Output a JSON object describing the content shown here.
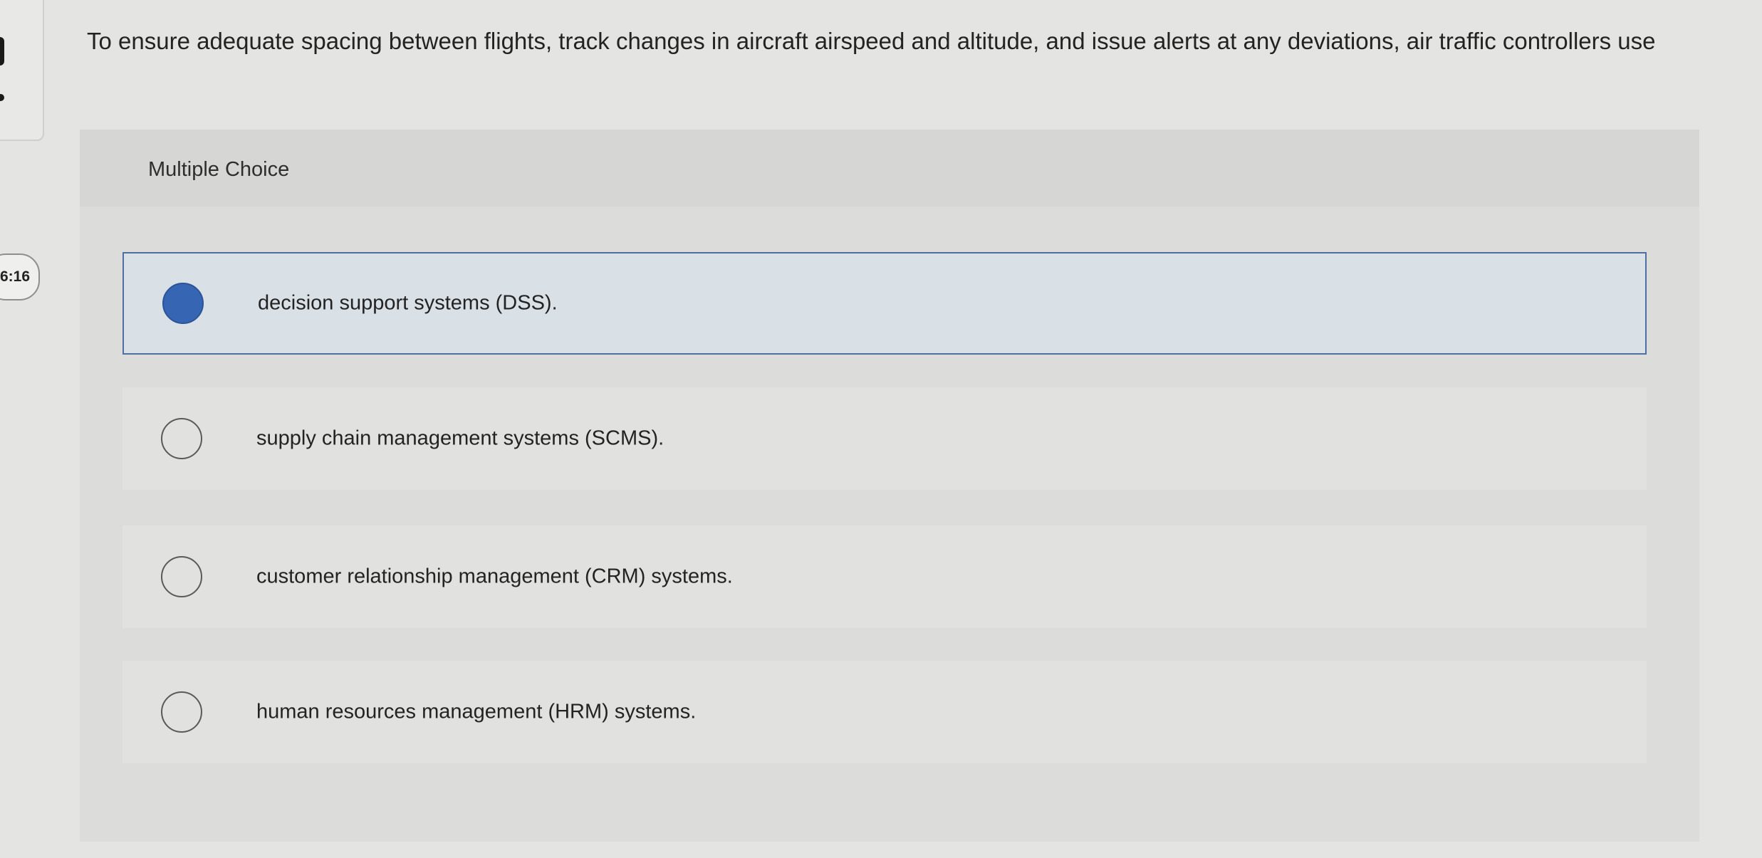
{
  "timer": "6:16",
  "question": {
    "text": "To ensure adequate spacing between flights, track changes in aircraft airspeed and altitude, and issue alerts at any deviations, air traffic controllers use"
  },
  "card": {
    "type_label": "Multiple Choice"
  },
  "options": [
    {
      "label": "decision support systems (DSS).",
      "selected": true
    },
    {
      "label": "supply chain management systems (SCMS).",
      "selected": false
    },
    {
      "label": "customer relationship management (CRM) systems.",
      "selected": false
    },
    {
      "label": "human resources management (HRM) systems.",
      "selected": false
    }
  ],
  "colors": {
    "selected_radio": "#3665b4",
    "selected_border": "#4f6fa3",
    "selected_background": "#d9e0e6"
  }
}
